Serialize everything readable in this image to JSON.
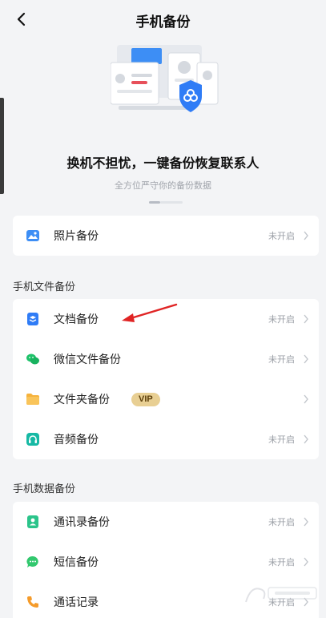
{
  "header": {
    "title": "手机备份",
    "back_icon": "chevron-left-icon"
  },
  "hero": {
    "heading": "换机不担忧，一键备份恢复联系人",
    "subtitle": "全方位严守你的备份数据",
    "illustration": "devices-cloud-shield-illustration"
  },
  "photo_card": {
    "items": [
      {
        "label": "照片备份",
        "status": "未开启",
        "icon": "photo-icon"
      }
    ]
  },
  "file_section": {
    "title": "手机文件备份",
    "items": [
      {
        "label": "文档备份",
        "status": "未开启",
        "icon": "document-icon"
      },
      {
        "label": "微信文件备份",
        "status": "未开启",
        "icon": "wechat-icon"
      },
      {
        "label": "文件夹备份",
        "badge": "VIP",
        "icon": "folder-icon"
      },
      {
        "label": "音频备份",
        "status": "未开启",
        "icon": "headphones-icon"
      }
    ]
  },
  "data_section": {
    "title": "手机数据备份",
    "items": [
      {
        "label": "通讯录备份",
        "status": "未开启",
        "icon": "contacts-icon"
      },
      {
        "label": "短信备份",
        "status": "未开启",
        "icon": "sms-icon"
      },
      {
        "label": "通话记录",
        "status": "未开启",
        "icon": "phone-icon"
      }
    ]
  },
  "colors": {
    "background": "#f3f4f6",
    "accent_blue": "#2f7cf6",
    "wechat_green": "#1ec26a",
    "folder_orange": "#f6b23c",
    "audio_teal": "#16b9a4",
    "contacts_green": "#2bc48a",
    "sms_green": "#32c86e",
    "phone_orange": "#f59b2a",
    "vip_gold": "#e8cf93",
    "annotation_red": "#e02424"
  }
}
